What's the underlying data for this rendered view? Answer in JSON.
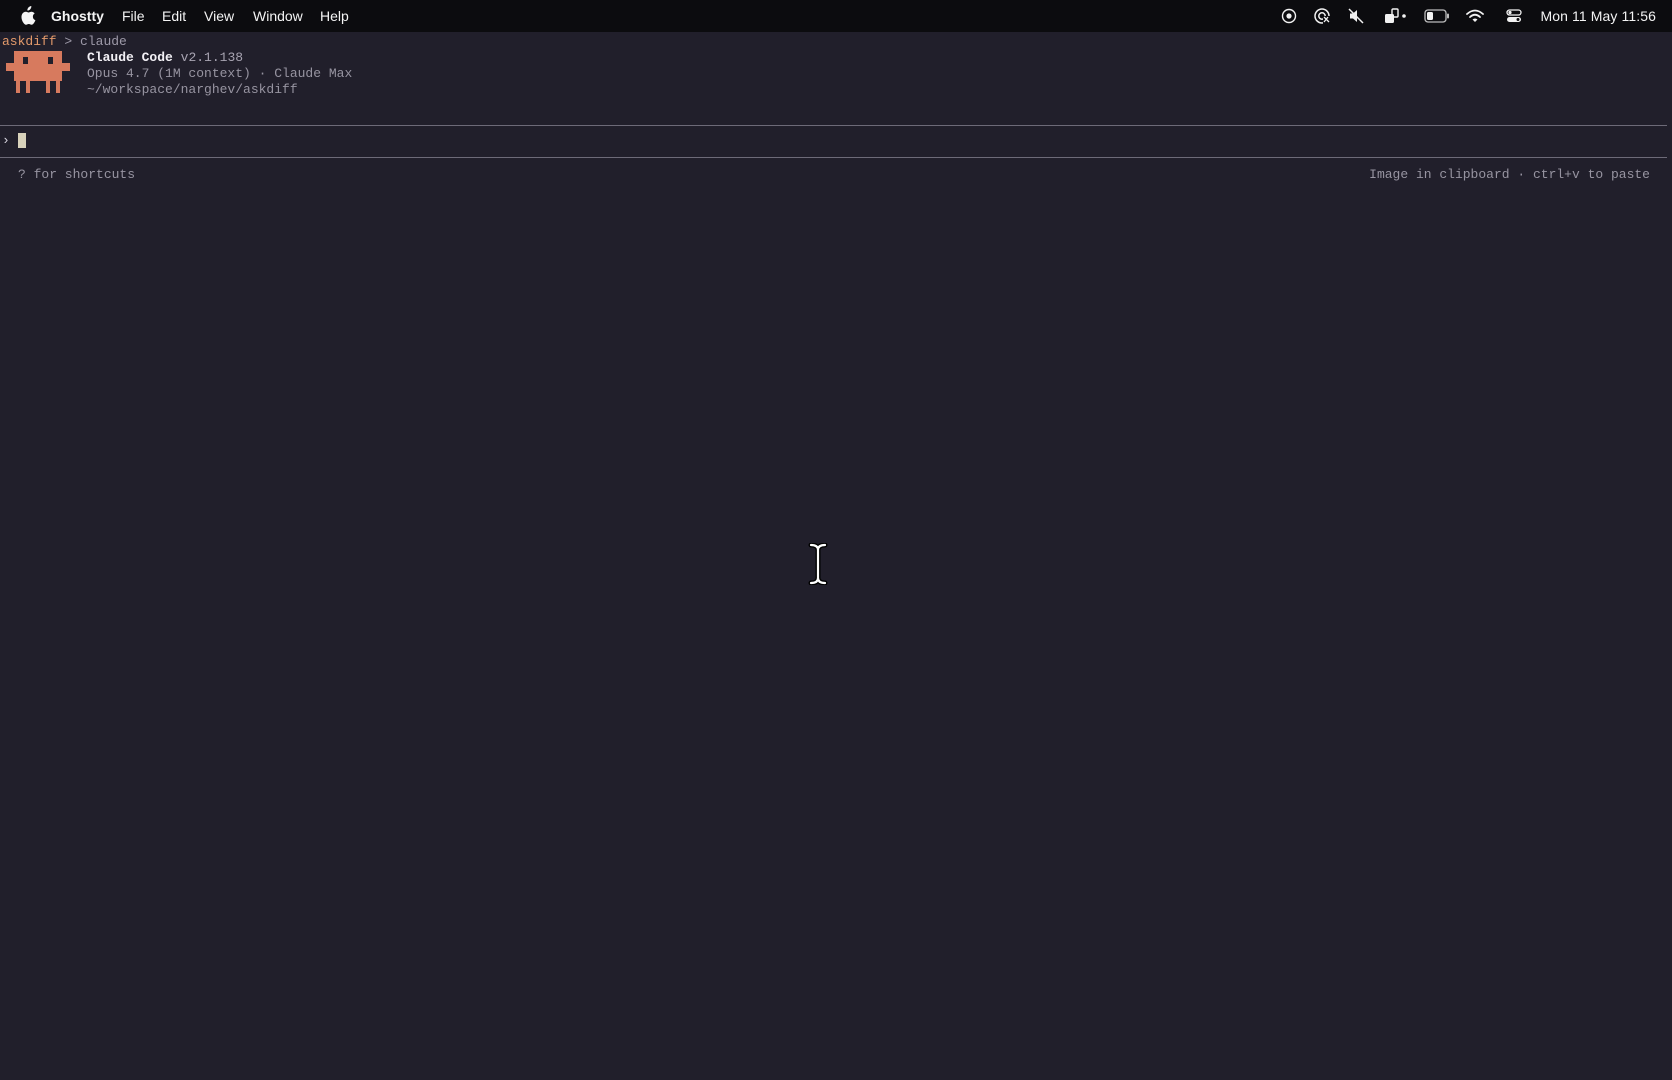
{
  "menubar": {
    "app_name": "Ghostty",
    "items": [
      "File",
      "Edit",
      "View",
      "Window",
      "Help"
    ],
    "tray_icons": [
      "screen-record-icon",
      "focus-icon",
      "mute-icon",
      "battery-extension-icon",
      "battery-icon",
      "wifi-icon",
      "control-center-icon"
    ],
    "clock": "Mon 11 May  11:56"
  },
  "terminal": {
    "prompt": {
      "directory": "askdiff",
      "separator": ">",
      "command": "claude"
    },
    "banner": {
      "title": "Claude Code",
      "version": "v2.1.138",
      "model_line": "Opus 4.7 (1M context) · Claude Max",
      "path": "~/workspace/narghev/askdiff"
    },
    "input": {
      "caret": "›",
      "value": ""
    },
    "footer": {
      "left_hint": "? for shortcuts",
      "right_hint": "Image in clipboard · ctrl+v to paste"
    }
  },
  "colors": {
    "terminal_bg": "#211f2b",
    "menubar_bg": "#0c0c0f",
    "mascot": "#d77a5e",
    "prompt_dir": "#e39a6b",
    "cursor": "#d8d2bb"
  }
}
